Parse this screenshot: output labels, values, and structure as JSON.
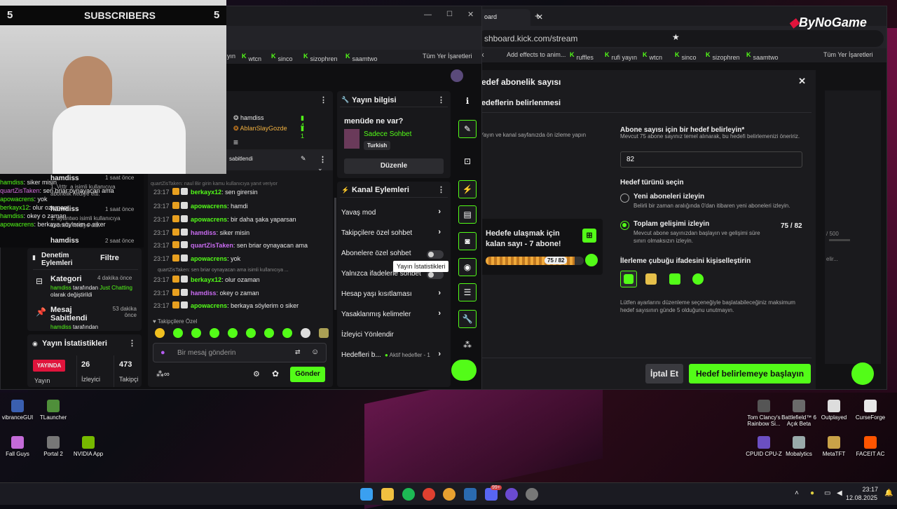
{
  "overlay": {
    "subscribers_label": "SUBSCRIBERS",
    "count_left": "5",
    "count_right": "5",
    "brand": "ByNoGame"
  },
  "left_chat": [
    {
      "name": "hamdiss",
      "text": "siker misin"
    },
    {
      "name": "quartZisTaken",
      "text": "sen briar oynayacan ama"
    },
    {
      "name": "apowacrens",
      "text": "yok"
    },
    {
      "name": "berkayx12",
      "text": "olur ozaman"
    },
    {
      "name": "hamdiss",
      "text": "okey o zaman"
    },
    {
      "name": "apowacrens",
      "text": "berkaya söylerim o siker"
    }
  ],
  "left_notifs": [
    {
      "user": "hamdiss",
      "time": "1 saat önce",
      "line1": "1. Vrttr_a isimli kullanıcıya",
      "line2": "abonelik hediye etti."
    },
    {
      "user": "hamdiss",
      "time": "1 saat önce",
      "line1": "1. ayllintwo isimli kullanıcıya",
      "line2": "abonelik hediye etti."
    },
    {
      "user": "hamdiss",
      "time": "2 saat önce"
    }
  ],
  "moderation": {
    "title": "Denetim\nEylemleri",
    "filter": "Filtre",
    "items": [
      {
        "label": "Kategori",
        "time": "4 dakika önce",
        "user": "hamdiss",
        "mid": " tarafından ",
        "value": "Just Chatting",
        "tail": " olarak değiştirildi"
      },
      {
        "label": "Mesaj Sabitlendi",
        "time": "53 dakika önce",
        "user": "hamdiss",
        "mid": " tarafından"
      }
    ]
  },
  "stream_stats": {
    "title": "Yayın İstatistikleri",
    "live": "YAYINDA",
    "live_sub": "Yayın",
    "viewers": "26",
    "viewers_label": "İzleyici",
    "followers": "473",
    "followers_label": "Takipçi"
  },
  "browser1": {
    "bookmarks": [
      "yın",
      "wtcn",
      "sinco",
      "sizophren",
      "saamtwo"
    ],
    "all_bookmarks": "Tüm Yer İşaretleri"
  },
  "leaderboard": [
    {
      "name": "hamdiss",
      "count": "4"
    },
    {
      "name": "AblanSlayGozde",
      "count": "1"
    }
  ],
  "pinned": {
    "label": "sabitlendi"
  },
  "chat": {
    "sys_top": "quartZisTaken: naul Bir girin kamu kullanıcıya yanıt veriyor",
    "messages": [
      {
        "time": "23:17",
        "name": "berkayx12",
        "text": "sen girersin"
      },
      {
        "time": "23:17",
        "name": "apowacrens",
        "text": "hamdi"
      },
      {
        "time": "23:17",
        "name": "apowacrens",
        "text": "bir daha şaka yaparsan"
      },
      {
        "time": "23:17",
        "name": "hamdiss",
        "text": "siker misin"
      },
      {
        "time": "23:17",
        "name": "quartZisTaken",
        "text": "sen briar oynayacan ama"
      },
      {
        "time": "23:17",
        "name": "apowacrens",
        "text": "yok"
      },
      {
        "time": "23:17",
        "name": "berkayx12",
        "text": "olur ozaman"
      },
      {
        "time": "23:17",
        "name": "hamdiss",
        "text": "okey o zaman"
      },
      {
        "time": "23:17",
        "name": "apowacrens",
        "text": "berkaya söylerim o siker"
      }
    ],
    "reply_note": "quartZisTaken: sen briar oynayacan ama isimli kullanıcıya ...",
    "followers_only": "Takipçilere Özel",
    "placeholder": "Bir mesaj gönderin",
    "send": "Gönder"
  },
  "stream_info": {
    "title": "Yayın bilgisi",
    "question": "menüde ne var?",
    "category": "Sadece Sohbet",
    "language": "Turkish",
    "edit": "Düzenle"
  },
  "channel_actions": {
    "title": "Kanal Eylemleri",
    "items": [
      {
        "label": "Yavaş mod",
        "kind": "chev"
      },
      {
        "label": "Takipçilere özel sohbet",
        "kind": "chev"
      },
      {
        "label": "Abonelere özel sohbet",
        "kind": "toggle"
      },
      {
        "label": "Yalnızca ifadelerle sohbet",
        "kind": "toggle"
      },
      {
        "label": "Hesap yaşı kısıtlaması",
        "kind": "chev"
      },
      {
        "label": "Yasaklanmış kelimeler",
        "kind": "chev"
      },
      {
        "label": "İzleyici Yönlendir",
        "kind": "none"
      },
      {
        "label": "Hedefleri b...",
        "kind": "chev",
        "extra": "Aktif hedefler - 1"
      }
    ]
  },
  "tooltip": "Yayın İstatistikleri",
  "browser2": {
    "tab": "oard",
    "url": "shboard.kick.com/stream",
    "bookmarks": [
      "rix",
      "Add effects to anim...",
      "ruffles",
      "rufi yayın",
      "wtcn",
      "sinco",
      "sizophren",
      "saamtwo"
    ],
    "all_bookmarks": "Tüm Yer İşaretleri"
  },
  "goal_modal": {
    "title": "edef abonelik sayısı",
    "subtitle": "edeflerin belirlenmesi",
    "desc": "Yayın ve kanal sayfanızda ön izleme yapın",
    "preview_text": "Hedefe ulaşmak için kalan sayı - 7 abone!",
    "preview_progress": "75 / 82",
    "progress_fraction": 0.91,
    "target_label": "Abone sayısı için bir hedef belirleyin*",
    "target_hint": "Mevcut 75 abone sayınız temel alınarak, bu hedefi belirlemenizi öneririz.",
    "target_value": "82",
    "type_label": "Hedef türünü seçin",
    "opt1": "Yeni aboneleri izleyin",
    "opt1_desc": "Belirli bir zaman aralığında 0'dan itibaren yeni aboneleri izleyin.",
    "opt2": "Toplam gelişimi izleyin",
    "opt2_desc": "Mevcut abone sayınızdan başlayın ve gelişimi süre sınırı olmaksızın izleyin.",
    "opt2_value": "75 / 82",
    "custom_label": "İlerleme çubuğu ifadesini kişiselleştirin",
    "note": "Lütfen ayarlarını düzenleme seçeneğiyle başlatabileceğiniz maksimum hedef sayısının günde 5 olduğunu unutmayın.",
    "cancel": "İptal Et",
    "start": "Hedef belirlemeye başlayın"
  },
  "right_hint": {
    "text": "/ 500",
    "sub": "elir..."
  },
  "desktop_icons": [
    {
      "label": "vibranceGUI"
    },
    {
      "label": "TLauncher"
    },
    {
      "label": "Fall Guys"
    },
    {
      "label": "Portal 2"
    },
    {
      "label": "NVIDIA App"
    },
    {
      "label": "Tom Clancy's Rainbow Si..."
    },
    {
      "label": "Battlefield™ 6 Açık Beta"
    },
    {
      "label": "Outplayed"
    },
    {
      "label": "CurseForge"
    },
    {
      "label": "CPUID CPU-Z"
    },
    {
      "label": "Mobalytics"
    },
    {
      "label": "MetaTFT"
    },
    {
      "label": "FACEIT AC"
    }
  ],
  "taskbar": {
    "time": "23:17",
    "date": "12.08.2025",
    "badge": "99+"
  },
  "colors": {
    "kick_green": "#53fc18",
    "live_red": "#e0143c"
  }
}
